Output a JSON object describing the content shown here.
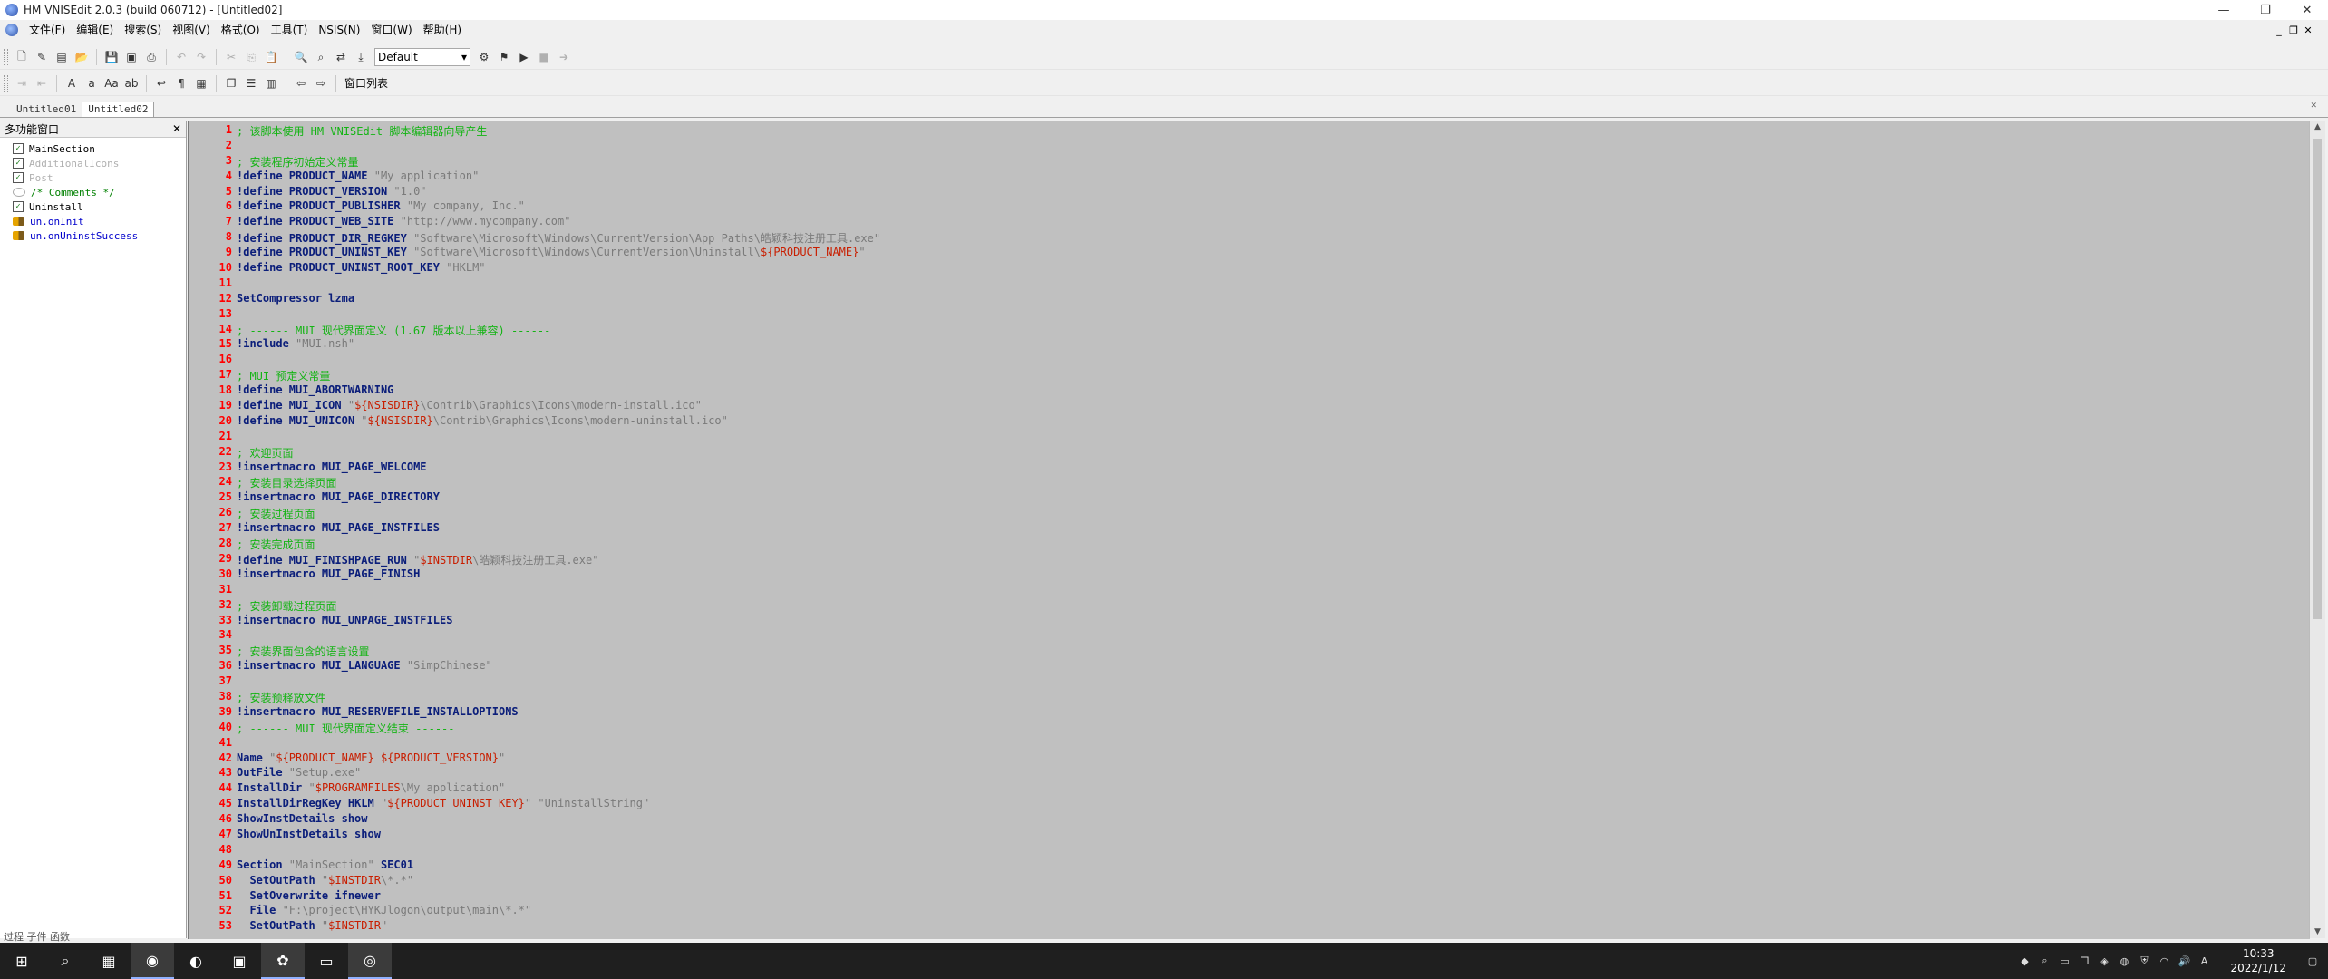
{
  "window": {
    "title": "HM VNISEdit 2.0.3 (build 060712) - [Untitled02]",
    "controls": [
      "—",
      "❐",
      "✕"
    ]
  },
  "menu": {
    "items": [
      "文件(F)",
      "编辑(E)",
      "搜索(S)",
      "视图(V)",
      "格式(O)",
      "工具(T)",
      "NSIS(N)",
      "窗口(W)",
      "帮助(H)"
    ],
    "mdi_controls": [
      "_",
      "❐",
      "✕"
    ]
  },
  "toolbar": {
    "scheme_value": "Default",
    "window_list_label": "窗口列表"
  },
  "tabs": [
    "Untitled01",
    "Untitled02"
  ],
  "panel": {
    "title": "多功能窗口",
    "close": "✕",
    "footer": "过程  子件  函数",
    "tree": [
      {
        "label": "MainSection",
        "type": "checked",
        "color": "#000000"
      },
      {
        "label": "AdditionalIcons",
        "type": "checked",
        "color": "#b0b0b0"
      },
      {
        "label": "Post",
        "type": "checked",
        "color": "#b0b0b0"
      },
      {
        "label": "/* Comments */",
        "type": "comment",
        "color": "#008000"
      },
      {
        "label": "Uninstall",
        "type": "checked",
        "color": "#000000"
      },
      {
        "label": "un.onInit",
        "type": "function",
        "color": "#0000cc"
      },
      {
        "label": "un.onUninstSuccess",
        "type": "function",
        "color": "#0000cc"
      }
    ]
  },
  "editor": {
    "lines": [
      {
        "n": "1",
        "segs": [
          [
            "cmt",
            "; 该脚本使用 HM VNISEdit 脚本编辑器向导产生"
          ]
        ]
      },
      {
        "n": "2",
        "segs": []
      },
      {
        "n": "3",
        "segs": [
          [
            "cmt",
            "; 安装程序初始定义常量"
          ]
        ]
      },
      {
        "n": "4",
        "segs": [
          [
            "kw",
            "!define PRODUCT_NAME "
          ],
          [
            "str",
            "\"My application\""
          ]
        ]
      },
      {
        "n": "5",
        "segs": [
          [
            "kw",
            "!define PRODUCT_VERSION "
          ],
          [
            "str",
            "\"1.0\""
          ]
        ]
      },
      {
        "n": "6",
        "segs": [
          [
            "kw",
            "!define PRODUCT_PUBLISHER "
          ],
          [
            "str",
            "\"My company, Inc.\""
          ]
        ]
      },
      {
        "n": "7",
        "segs": [
          [
            "kw",
            "!define PRODUCT_WEB_SITE "
          ],
          [
            "str",
            "\"http://www.mycompany.com\""
          ]
        ]
      },
      {
        "n": "8",
        "segs": [
          [
            "kw",
            "!define PRODUCT_DIR_REGKEY "
          ],
          [
            "str",
            "\"Software\\Microsoft\\Windows\\CurrentVersion\\App Paths\\皓颖科技注册工具.exe\""
          ]
        ]
      },
      {
        "n": "9",
        "segs": [
          [
            "kw",
            "!define PRODUCT_UNINST_KEY "
          ],
          [
            "str",
            "\"Software\\Microsoft\\Windows\\CurrentVersion\\Uninstall\\"
          ],
          [
            "var",
            "${PRODUCT_NAME}"
          ],
          [
            "str",
            "\""
          ]
        ]
      },
      {
        "n": "10",
        "segs": [
          [
            "kw",
            "!define PRODUCT_UNINST_ROOT_KEY "
          ],
          [
            "str",
            "\"HKLM\""
          ]
        ]
      },
      {
        "n": "11",
        "segs": []
      },
      {
        "n": "12",
        "segs": [
          [
            "kw",
            "SetCompressor "
          ],
          [
            "kw",
            "lzma"
          ]
        ]
      },
      {
        "n": "13",
        "segs": []
      },
      {
        "n": "14",
        "segs": [
          [
            "cmt",
            "; ------ MUI 现代界面定义 (1.67 版本以上兼容) ------"
          ]
        ]
      },
      {
        "n": "15",
        "segs": [
          [
            "kw",
            "!include "
          ],
          [
            "str",
            "\"MUI.nsh\""
          ]
        ]
      },
      {
        "n": "16",
        "segs": []
      },
      {
        "n": "17",
        "segs": [
          [
            "cmt",
            "; MUI 预定义常量"
          ]
        ]
      },
      {
        "n": "18",
        "segs": [
          [
            "kw",
            "!define MUI_ABORTWARNING"
          ]
        ]
      },
      {
        "n": "19",
        "segs": [
          [
            "kw",
            "!define MUI_ICON "
          ],
          [
            "str",
            "\""
          ],
          [
            "var",
            "${NSISDIR}"
          ],
          [
            "str",
            "\\Contrib\\Graphics\\Icons\\modern-install.ico\""
          ]
        ]
      },
      {
        "n": "20",
        "segs": [
          [
            "kw",
            "!define MUI_UNICON "
          ],
          [
            "str",
            "\""
          ],
          [
            "var",
            "${NSISDIR}"
          ],
          [
            "str",
            "\\Contrib\\Graphics\\Icons\\modern-uninstall.ico\""
          ]
        ]
      },
      {
        "n": "21",
        "segs": []
      },
      {
        "n": "22",
        "segs": [
          [
            "cmt",
            "; 欢迎页面"
          ]
        ]
      },
      {
        "n": "23",
        "segs": [
          [
            "kw",
            "!insertmacro MUI_PAGE_WELCOME"
          ]
        ]
      },
      {
        "n": "24",
        "segs": [
          [
            "cmt",
            "; 安装目录选择页面"
          ]
        ]
      },
      {
        "n": "25",
        "segs": [
          [
            "kw",
            "!insertmacro MUI_PAGE_DIRECTORY"
          ]
        ]
      },
      {
        "n": "26",
        "segs": [
          [
            "cmt",
            "; 安装过程页面"
          ]
        ]
      },
      {
        "n": "27",
        "segs": [
          [
            "kw",
            "!insertmacro MUI_PAGE_INSTFILES"
          ]
        ]
      },
      {
        "n": "28",
        "segs": [
          [
            "cmt",
            "; 安装完成页面"
          ]
        ]
      },
      {
        "n": "29",
        "segs": [
          [
            "kw",
            "!define MUI_FINISHPAGE_RUN "
          ],
          [
            "str",
            "\""
          ],
          [
            "var",
            "$INSTDIR"
          ],
          [
            "str",
            "\\皓颖科技注册工具.exe\""
          ]
        ]
      },
      {
        "n": "30",
        "segs": [
          [
            "kw",
            "!insertmacro MUI_PAGE_FINISH"
          ]
        ]
      },
      {
        "n": "31",
        "segs": []
      },
      {
        "n": "32",
        "segs": [
          [
            "cmt",
            "; 安装卸载过程页面"
          ]
        ]
      },
      {
        "n": "33",
        "segs": [
          [
            "kw",
            "!insertmacro MUI_UNPAGE_INSTFILES"
          ]
        ]
      },
      {
        "n": "34",
        "segs": []
      },
      {
        "n": "35",
        "segs": [
          [
            "cmt",
            "; 安装界面包含的语言设置"
          ]
        ]
      },
      {
        "n": "36",
        "segs": [
          [
            "kw",
            "!insertmacro MUI_LANGUAGE "
          ],
          [
            "str",
            "\"SimpChinese\""
          ]
        ]
      },
      {
        "n": "37",
        "segs": []
      },
      {
        "n": "38",
        "segs": [
          [
            "cmt",
            "; 安装预释放文件"
          ]
        ]
      },
      {
        "n": "39",
        "segs": [
          [
            "kw",
            "!insertmacro MUI_RESERVEFILE_INSTALLOPTIONS"
          ]
        ]
      },
      {
        "n": "40",
        "segs": [
          [
            "cmt",
            "; ------ MUI 现代界面定义结束 ------"
          ]
        ]
      },
      {
        "n": "41",
        "segs": []
      },
      {
        "n": "42",
        "segs": [
          [
            "kw",
            "Name "
          ],
          [
            "str",
            "\""
          ],
          [
            "var",
            "${PRODUCT_NAME} ${PRODUCT_VERSION}"
          ],
          [
            "str",
            "\""
          ]
        ]
      },
      {
        "n": "43",
        "segs": [
          [
            "kw",
            "OutFile "
          ],
          [
            "str",
            "\"Setup.exe\""
          ]
        ]
      },
      {
        "n": "44",
        "segs": [
          [
            "kw",
            "InstallDir "
          ],
          [
            "str",
            "\""
          ],
          [
            "var",
            "$PROGRAMFILES"
          ],
          [
            "str",
            "\\My application\""
          ]
        ]
      },
      {
        "n": "45",
        "segs": [
          [
            "kw",
            "InstallDirRegKey HKLM "
          ],
          [
            "str",
            "\""
          ],
          [
            "var",
            "${PRODUCT_UNINST_KEY}"
          ],
          [
            "str",
            "\" \"UninstallString\""
          ]
        ]
      },
      {
        "n": "46",
        "segs": [
          [
            "kw",
            "ShowInstDetails show"
          ]
        ]
      },
      {
        "n": "47",
        "segs": [
          [
            "kw",
            "ShowUnInstDetails show"
          ]
        ]
      },
      {
        "n": "48",
        "segs": []
      },
      {
        "n": "49",
        "segs": [
          [
            "kw",
            "Section "
          ],
          [
            "str",
            "\"MainSection\" "
          ],
          [
            "kw",
            "SEC01"
          ]
        ]
      },
      {
        "n": "50",
        "segs": [
          [
            "kw",
            "  SetOutPath "
          ],
          [
            "str",
            "\""
          ],
          [
            "var",
            "$INSTDIR"
          ],
          [
            "str",
            "\\*.*\""
          ]
        ]
      },
      {
        "n": "51",
        "segs": [
          [
            "kw",
            "  SetOverwrite ifnewer"
          ]
        ]
      },
      {
        "n": "52",
        "segs": [
          [
            "kw",
            "  File "
          ],
          [
            "str",
            "\"F:\\project\\HYKJlogon\\output\\main\\*.*\""
          ]
        ]
      },
      {
        "n": "53",
        "segs": [
          [
            "kw",
            "  SetOutPath "
          ],
          [
            "str",
            "\""
          ],
          [
            "var",
            "$INSTDIR"
          ],
          [
            "str",
            "\""
          ]
        ]
      }
    ]
  },
  "taskbar": {
    "icons": [
      "windows-start-icon",
      "search-icon",
      "calculator-icon",
      "chrome-icon",
      "edge-icon",
      "pycharm-icon",
      "app-icon",
      "folder-icon",
      "nsis-icon"
    ],
    "ime": "A",
    "time": "10:33",
    "date": "2022/1/12"
  }
}
